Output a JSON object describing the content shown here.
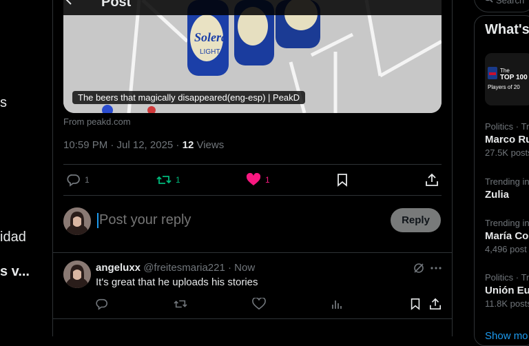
{
  "left_nav": {
    "item1": "s",
    "item2": "idad",
    "item3": "s v..."
  },
  "header": {
    "title": "Post"
  },
  "card": {
    "caption": "The beers that magically disappeared(eng-esp) | PeakD",
    "source": "From peakd.com",
    "bottle_label": "Solera",
    "bottle_sub": "LIGHT"
  },
  "meta": {
    "time": "10:59 PM · Jul 12, 2025 · ",
    "views_count": "12",
    "views_label": " Views"
  },
  "actions": {
    "replies": "1",
    "reposts": "1",
    "likes": "1"
  },
  "reply_box": {
    "placeholder": "Post your reply",
    "button": "Reply"
  },
  "comment": {
    "name": "angeluxx",
    "handle": "@freitesmaria221",
    "sep": " · ",
    "time": "Now",
    "text": "It's great that he uploads his stories"
  },
  "sidebar": {
    "search_placeholder": "Search",
    "whats_happening": "What's",
    "promo_top": "The",
    "promo_mid": "TOP 100",
    "promo_bottom": "Players of 20",
    "trends": [
      {
        "category": "Politics · Tre",
        "title": "Marco Ru",
        "count": "27.5K posts"
      },
      {
        "category": "Trending in",
        "title": "Zulia",
        "count": ""
      },
      {
        "category": "Trending in",
        "title": "María Co",
        "count": "4,496 post"
      },
      {
        "category": "Politics · Tr",
        "title": "Unión Eu",
        "count": "11.8K posts"
      }
    ],
    "show_more": "Show mo"
  },
  "colors": {
    "accent": "#1d9bf0",
    "repost": "#00ba7c",
    "like": "#f91880",
    "border": "#2f3336"
  }
}
